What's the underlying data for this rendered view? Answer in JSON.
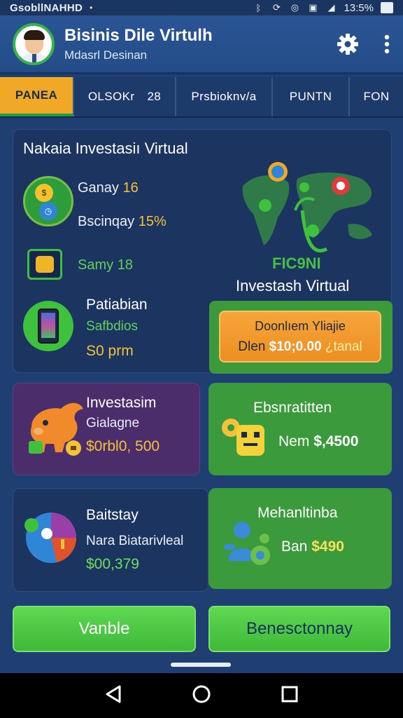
{
  "status": {
    "carrier": "GsobllNAHHD",
    "battery_text": "13:5%"
  },
  "header": {
    "title": "Bisinis Dile Virtulh",
    "subtitle": "Mdasrl Desinan",
    "icons": [
      "gear-icon",
      "more-vert-icon"
    ]
  },
  "tabs": [
    {
      "label": "PANEA",
      "count": "",
      "active": true
    },
    {
      "label": "OLSOKr",
      "count": "28",
      "active": false
    },
    {
      "label": "Prsbioknv/a",
      "count": "",
      "active": false
    },
    {
      "label": "PUNTN",
      "count": "",
      "active": false
    },
    {
      "label": "FON",
      "count": "",
      "active": false
    }
  ],
  "hero": {
    "title": "Nakaia Investasiı Virtual",
    "stat1_label": "Ganay",
    "stat1_value": "16",
    "stat2_label": "Bscinqay",
    "stat2_value": "15%",
    "stat3_label": "Samy",
    "stat3_value": "18",
    "pay_title": "Patiabian",
    "pay_sub": "Safbdios",
    "pay_value": "S0 prm",
    "map_label": "FIC9NI",
    "map_caption": "Investash Virtual",
    "cta_line1": "Doonlıem Yliajie",
    "cta_line2_prefix": "Dlen",
    "cta_amount": "$10;0.00",
    "cta_total": "¿tanal"
  },
  "cards": {
    "invest": {
      "title": "Investasim",
      "sub": "Gialagne",
      "value": "$0rbl0, 500"
    },
    "ekspan": {
      "title": "Ebsnratitten",
      "label": "Nem",
      "value": "$,4500"
    },
    "bait": {
      "title": "Baitstay",
      "sub": "Nara Biatarivleal",
      "value": "$00,379"
    },
    "mech": {
      "title": "Mehanltinba",
      "label": "Ban",
      "value": "$490"
    }
  },
  "buttons": {
    "left": "Vanble",
    "right": "Benesctonnay"
  },
  "colors": {
    "accent_orange": "#f0a826",
    "accent_green": "#3ec23e",
    "background": "#1f3f73",
    "card_purple": "#4a2d6a",
    "value_gold": "#f4c23a"
  }
}
